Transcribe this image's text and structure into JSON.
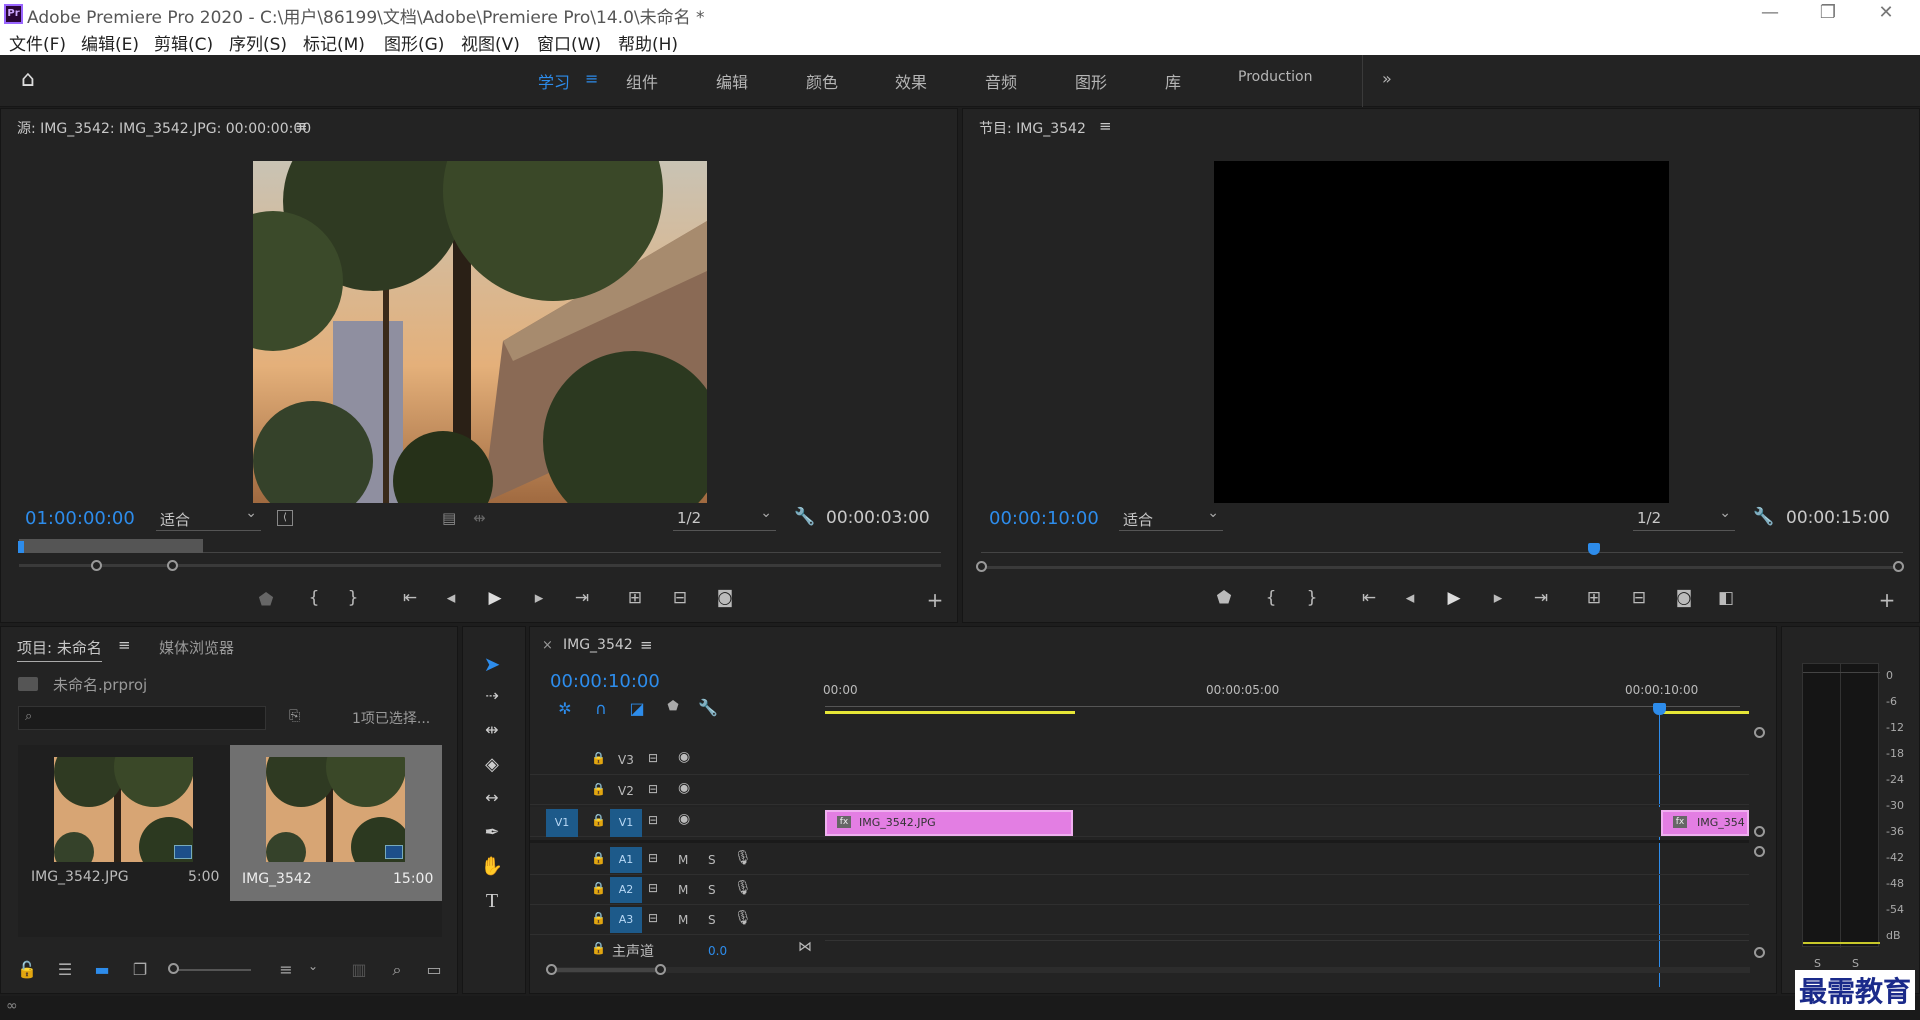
{
  "app": {
    "title": "Adobe Premiere Pro 2020 - C:\\用户\\86199\\文档\\Adobe\\Premiere Pro\\14.0\\未命名 *",
    "logo": "Pr"
  },
  "menu": [
    "文件(F)",
    "编辑(E)",
    "剪辑(C)",
    "序列(S)",
    "标记(M)",
    "图形(G)",
    "视图(V)",
    "窗口(W)",
    "帮助(H)"
  ],
  "workspaces": {
    "learn": "学习",
    "assembly": "组件",
    "editing": "编辑",
    "color": "颜色",
    "effects": "效果",
    "audio": "音频",
    "graphics": "图形",
    "libraries": "库",
    "production": "Production",
    "more": "»"
  },
  "source": {
    "title": "源: IMG_3542: IMG_3542.JPG: 00:00:00:00",
    "timecode": "01:00:00:00",
    "fit": "适合",
    "resolution": "1/2",
    "duration": "00:00:03:00"
  },
  "program": {
    "title": "节目: IMG_3542",
    "timecode": "00:00:10:00",
    "fit": "适合",
    "resolution": "1/2",
    "duration": "00:00:15:00"
  },
  "project": {
    "tab_project": "项目: 未命名",
    "tab_media": "媒体浏览器",
    "file": "未命名.prproj",
    "selection": "1项已选择...",
    "items": [
      {
        "name": "IMG_3542.JPG",
        "duration": "5:00"
      },
      {
        "name": "IMG_3542",
        "duration": "15:00"
      }
    ]
  },
  "timeline": {
    "tab": "IMG_3542",
    "timecode": "00:00:10:00",
    "ruler": [
      "00:00",
      "00:00:05:00",
      "00:00:10:00"
    ],
    "tracks": {
      "v3": "V3",
      "v2": "V2",
      "v1": "V1",
      "v1src": "V1",
      "a1": "A1",
      "a2": "A2",
      "a3": "A3",
      "m": "M",
      "s": "S",
      "master": "主声道",
      "master_val": "0.0"
    },
    "clip1": "IMG_3542.JPG",
    "clip2": "IMG_354"
  },
  "meter": {
    "scale": [
      "0",
      "-6",
      "-12",
      "-18",
      "-24",
      "-30",
      "-36",
      "-42",
      "-48",
      "-54",
      "dB"
    ],
    "solo": [
      "S",
      "S"
    ]
  },
  "watermark": "最需教育"
}
